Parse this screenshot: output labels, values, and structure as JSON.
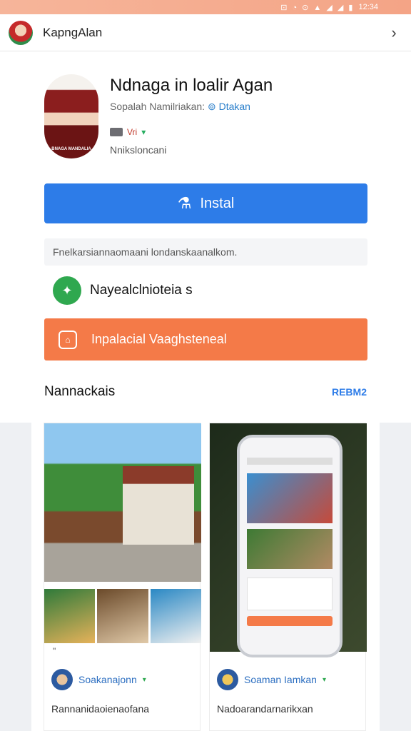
{
  "status_bar": {
    "time": "12:34",
    "icons": "⊡ ◔ ⊙ ▲ ◢ ◢ ▮"
  },
  "app_bar": {
    "title": "KapngAlan"
  },
  "app": {
    "name": "Ndnaga in loalir Agan",
    "subtitle": "Sopalah Namilriakan:",
    "developer": "Dtakan",
    "rating_red": "Vri",
    "rating_green": "▾",
    "meta": "Nniksloncani",
    "hero_caption": "BNAGA MANDALIA"
  },
  "install": {
    "label": "Instal"
  },
  "info_strip": "Fnelkarsiannaomaani londanskaanalkom.",
  "feature": {
    "label": "Nayealclnioteia s"
  },
  "promo": {
    "label": "Inpalacial Vaaghsteneal"
  },
  "section": {
    "title": "Nannackais",
    "link": "REBM2"
  },
  "cards": [
    {
      "caption": "\"",
      "author": "Soakanajonn",
      "check": "▾",
      "footer": "Rannanidaoienaofana"
    },
    {
      "caption": "",
      "author": "Soaman Iamkan",
      "check": "▾",
      "footer": "Nadoarandarnarikxan"
    }
  ],
  "colors": {
    "install_blue": "#2d7ce8",
    "promo_orange": "#f47a48",
    "feature_green": "#2fa84f",
    "link_blue": "#2d7ce8"
  }
}
